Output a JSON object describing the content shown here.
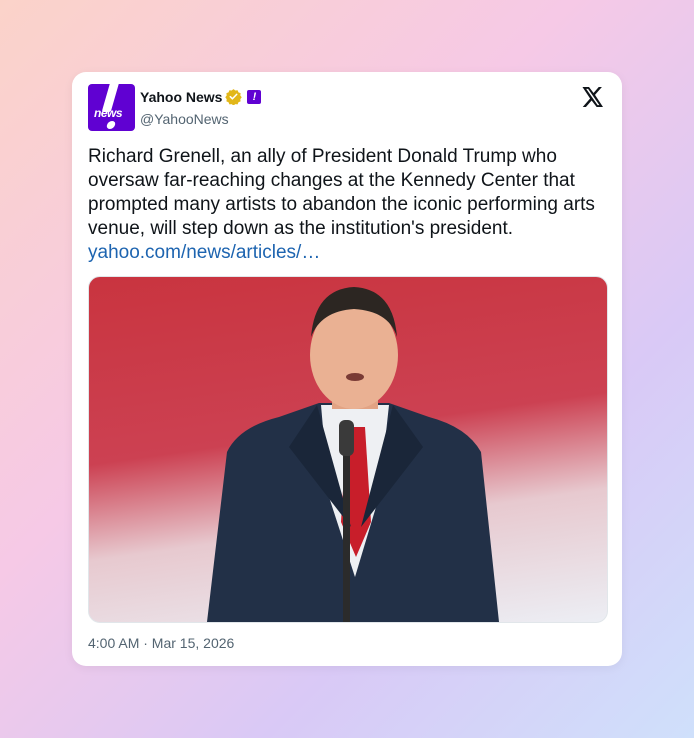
{
  "tweet": {
    "author_name": "Yahoo News",
    "author_handle": "@YahooNews",
    "avatar_text": "news",
    "text": "Richard Grenell, an ally of President Donald Trump who oversaw far-reaching changes at the Kennedy Center that prompted many artists to abandon the iconic performing arts venue, will step down as the institution's president.",
    "link": "yahoo.com/news/articles/…",
    "timestamp": "4:00 AM · Mar 15, 2026",
    "verified_badge": "gold-verified-icon",
    "affiliate_badge": "yahoo-exclamation-icon",
    "platform_icon": "x-logo-icon"
  },
  "colors": {
    "brand": "#6001d2",
    "link": "#1d64b0",
    "verified_gold": "#e2b719",
    "text": "#0f1419",
    "muted": "#536471"
  }
}
